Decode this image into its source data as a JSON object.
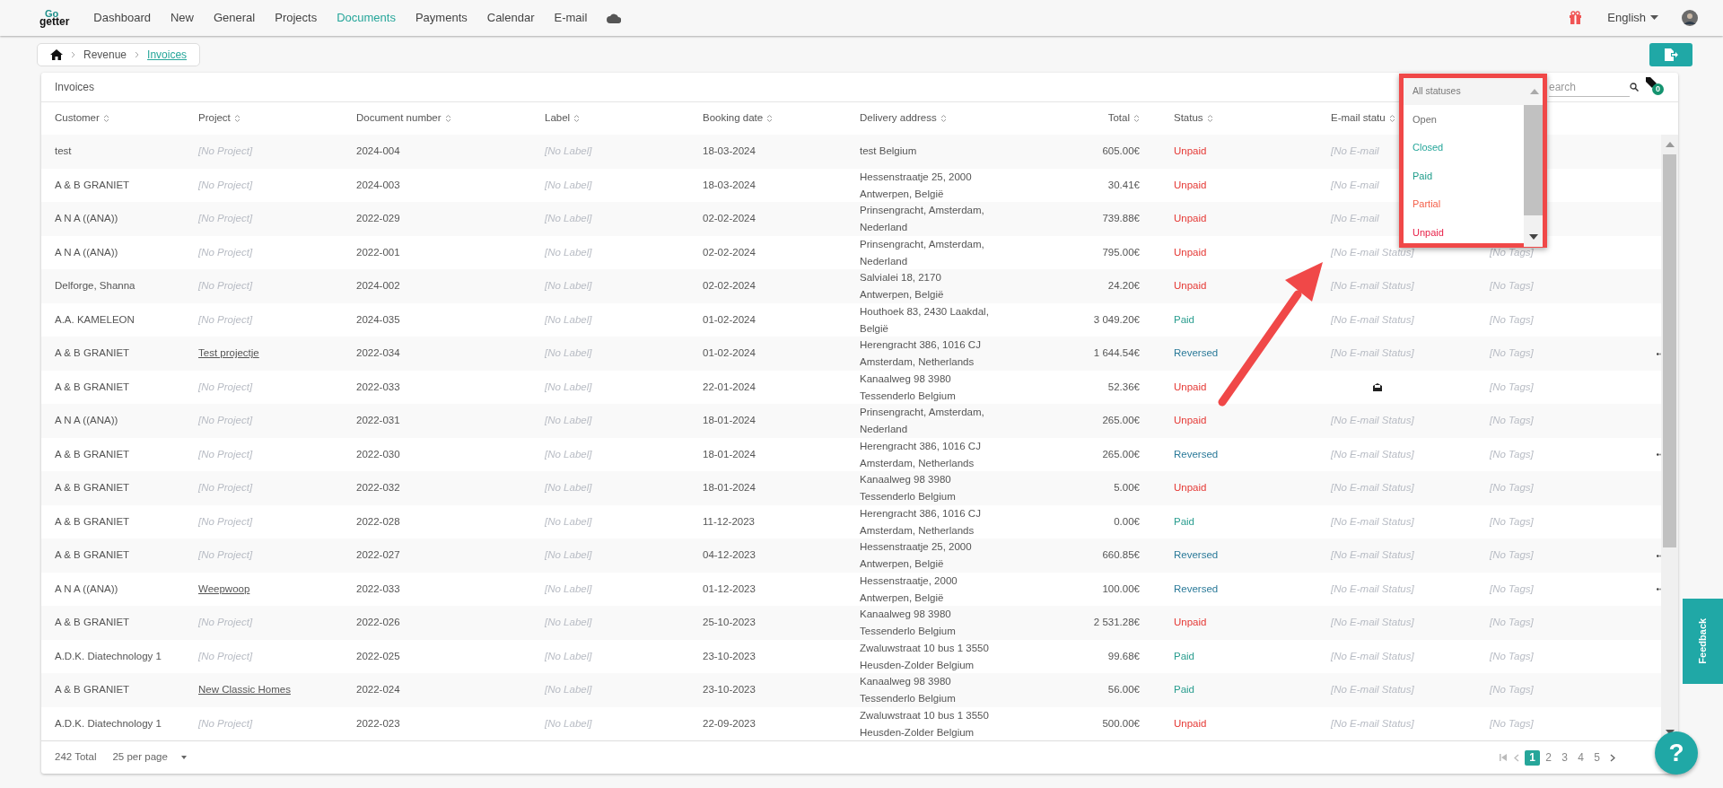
{
  "logo": {
    "top": "Go",
    "bottom": "getter"
  },
  "nav": [
    {
      "label": "Dashboard",
      "selected": false
    },
    {
      "label": "New",
      "selected": false
    },
    {
      "label": "General",
      "selected": false
    },
    {
      "label": "Projects",
      "selected": false
    },
    {
      "label": "Documents",
      "selected": true
    },
    {
      "label": "Payments",
      "selected": false
    },
    {
      "label": "Calendar",
      "selected": false
    },
    {
      "label": "E-mail",
      "selected": false
    }
  ],
  "language": "English",
  "breadcrumb": [
    "Revenue",
    "Invoices"
  ],
  "card_title": "Invoices",
  "search": {
    "placeholder": "earch"
  },
  "tag_count": "0",
  "columns": [
    "Customer",
    "Project",
    "Document number",
    "Label",
    "Booking date",
    "Delivery address",
    "Total",
    "Status",
    "E-mail statu"
  ],
  "rows": [
    {
      "customer": "test",
      "project": "[No Project]",
      "project_link": false,
      "document": "2024-004",
      "label": "[No Label]",
      "date": "18-03-2024",
      "address": [
        "test Belgium"
      ],
      "total": "605.00€",
      "status": "Unpaid",
      "color": "#e53935",
      "email_icon": false,
      "email_status": "[No E-mail",
      "menu": false
    },
    {
      "customer": "A & B GRANIET",
      "project": "[No Project]",
      "project_link": false,
      "document": "2024-003",
      "label": "[No Label]",
      "date": "18-03-2024",
      "address": [
        "Hessenstraatje 25, 2000",
        "Antwerpen, België"
      ],
      "total": "30.41€",
      "status": "Unpaid",
      "color": "#e53935",
      "email_icon": false,
      "email_status": "[No E-mail",
      "menu": false
    },
    {
      "customer": "A N A ((ANA))",
      "project": "[No Project]",
      "project_link": false,
      "document": "2022-029",
      "label": "[No Label]",
      "date": "02-02-2024",
      "address": [
        "Prinsengracht, Amsterdam,",
        "Nederland"
      ],
      "total": "739.88€",
      "status": "Unpaid",
      "color": "#e53935",
      "email_icon": false,
      "email_status": "[No E-mail",
      "menu": false
    },
    {
      "customer": "A N A ((ANA))",
      "project": "[No Project]",
      "project_link": false,
      "document": "2022-001",
      "label": "[No Label]",
      "date": "02-02-2024",
      "address": [
        "Prinsengracht, Amsterdam,",
        "Nederland"
      ],
      "total": "795.00€",
      "status": "Unpaid",
      "color": "#e53935",
      "email_icon": false,
      "email_status": "[No E-mail Status]",
      "tags": "[No Tags]",
      "menu": false
    },
    {
      "customer": "Delforge, Shanna",
      "project": "[No Project]",
      "project_link": false,
      "document": "2024-002",
      "label": "[No Label]",
      "date": "02-02-2024",
      "address": [
        "Salvialei 18, 2170",
        "Antwerpen, België"
      ],
      "total": "24.20€",
      "status": "Unpaid",
      "color": "#e53935",
      "email_icon": false,
      "email_status": "[No E-mail Status]",
      "tags": "[No Tags]",
      "menu": false
    },
    {
      "customer": "A.A. KAMELEON",
      "project": "[No Project]",
      "project_link": false,
      "document": "2024-035",
      "label": "[No Label]",
      "date": "01-02-2024",
      "address": [
        "Houthoek 83, 2430 Laakdal,",
        "België"
      ],
      "total": "3 049.20€",
      "status": "Paid",
      "color": "#2a9d8f",
      "email_icon": false,
      "email_status": "[No E-mail Status]",
      "tags": "[No Tags]",
      "menu": false
    },
    {
      "customer": "A & B GRANIET",
      "project": "Test projectje",
      "project_link": true,
      "document": "2022-034",
      "label": "[No Label]",
      "date": "01-02-2024",
      "address": [
        "Herengracht 386, 1016 CJ",
        "Amsterdam, Netherlands"
      ],
      "total": "1 644.54€",
      "status": "Reversed",
      "color": "#2b7a99",
      "email_icon": false,
      "email_status": "[No E-mail Status]",
      "tags": "[No Tags]",
      "menu": true
    },
    {
      "customer": "A & B GRANIET",
      "project": "[No Project]",
      "project_link": false,
      "document": "2022-033",
      "label": "[No Label]",
      "date": "22-01-2024",
      "address": [
        "Kanaalweg 98 3980",
        "Tessenderlo Belgium"
      ],
      "total": "52.36€",
      "status": "Unpaid",
      "color": "#e53935",
      "email_icon": true,
      "tags": "[No Tags]",
      "menu": false
    },
    {
      "customer": "A N A ((ANA))",
      "project": "[No Project]",
      "project_link": false,
      "document": "2022-031",
      "label": "[No Label]",
      "date": "18-01-2024",
      "address": [
        "Prinsengracht, Amsterdam,",
        "Nederland"
      ],
      "total": "265.00€",
      "status": "Unpaid",
      "color": "#e53935",
      "email_icon": false,
      "email_status": "[No E-mail Status]",
      "tags": "[No Tags]",
      "menu": false
    },
    {
      "customer": "A & B GRANIET",
      "project": "[No Project]",
      "project_link": false,
      "document": "2022-030",
      "label": "[No Label]",
      "date": "18-01-2024",
      "address": [
        "Herengracht 386, 1016 CJ",
        "Amsterdam, Netherlands"
      ],
      "total": "265.00€",
      "status": "Reversed",
      "color": "#2b7a99",
      "email_icon": false,
      "email_status": "[No E-mail Status]",
      "tags": "[No Tags]",
      "menu": true
    },
    {
      "customer": "A & B GRANIET",
      "project": "[No Project]",
      "project_link": false,
      "document": "2022-032",
      "label": "[No Label]",
      "date": "18-01-2024",
      "address": [
        "Kanaalweg 98 3980",
        "Tessenderlo Belgium"
      ],
      "total": "5.00€",
      "status": "Unpaid",
      "color": "#e53935",
      "email_icon": false,
      "email_status": "[No E-mail Status]",
      "tags": "[No Tags]",
      "menu": false
    },
    {
      "customer": "A & B GRANIET",
      "project": "[No Project]",
      "project_link": false,
      "document": "2022-028",
      "label": "[No Label]",
      "date": "11-12-2023",
      "address": [
        "Herengracht 386, 1016 CJ",
        "Amsterdam, Netherlands"
      ],
      "total": "0.00€",
      "status": "Paid",
      "color": "#2a9d8f",
      "email_icon": false,
      "email_status": "[No E-mail Status]",
      "tags": "[No Tags]",
      "menu": false
    },
    {
      "customer": "A & B GRANIET",
      "project": "[No Project]",
      "project_link": false,
      "document": "2022-027",
      "label": "[No Label]",
      "date": "04-12-2023",
      "address": [
        "Hessenstraatje 25, 2000",
        "Antwerpen, België"
      ],
      "total": "660.85€",
      "status": "Reversed",
      "color": "#2b7a99",
      "email_icon": false,
      "email_status": "[No E-mail Status]",
      "tags": "[No Tags]",
      "menu": true
    },
    {
      "customer": "A N A ((ANA))",
      "project": "Weepwoop",
      "project_link": true,
      "document": "2022-033",
      "label": "[No Label]",
      "date": "01-12-2023",
      "address": [
        "Hessenstraatje, 2000",
        "Antwerpen, België"
      ],
      "total": "100.00€",
      "status": "Reversed",
      "color": "#2b7a99",
      "email_icon": false,
      "email_status": "[No E-mail Status]",
      "tags": "[No Tags]",
      "menu": true
    },
    {
      "customer": "A & B GRANIET",
      "project": "[No Project]",
      "project_link": false,
      "document": "2022-026",
      "label": "[No Label]",
      "date": "25-10-2023",
      "address": [
        "Kanaalweg 98 3980",
        "Tessenderlo Belgium"
      ],
      "total": "2 531.28€",
      "status": "Unpaid",
      "color": "#e53935",
      "email_icon": false,
      "email_status": "[No E-mail Status]",
      "tags": "[No Tags]",
      "menu": false
    },
    {
      "customer": "A.D.K. Diatechnology 1",
      "project": "[No Project]",
      "project_link": false,
      "document": "2022-025",
      "label": "[No Label]",
      "date": "23-10-2023",
      "address": [
        "Zwaluwstraat 10 bus 1 3550",
        "Heusden-Zolder Belgium"
      ],
      "total": "99.68€",
      "status": "Paid",
      "color": "#2a9d8f",
      "email_icon": false,
      "email_status": "[No E-mail Status]",
      "tags": "[No Tags]",
      "menu": false
    },
    {
      "customer": "A & B GRANIET",
      "project": "New Classic Homes",
      "project_link": true,
      "document": "2022-024",
      "label": "[No Label]",
      "date": "23-10-2023",
      "address": [
        "Kanaalweg 98 3980",
        "Tessenderlo Belgium"
      ],
      "total": "56.00€",
      "status": "Paid",
      "color": "#2a9d8f",
      "email_icon": false,
      "email_status": "[No E-mail Status]",
      "tags": "[No Tags]",
      "menu": false
    },
    {
      "customer": "A.D.K. Diatechnology 1",
      "project": "[No Project]",
      "project_link": false,
      "document": "2022-023",
      "label": "[No Label]",
      "date": "22-09-2023",
      "address": [
        "Zwaluwstraat 10 bus 1 3550",
        "Heusden-Zolder Belgium"
      ],
      "total": "500.00€",
      "status": "Unpaid",
      "color": "#e53935",
      "email_icon": false,
      "email_status": "[No E-mail Status]",
      "tags": "[No Tags]",
      "menu": false
    }
  ],
  "footer": {
    "total": "242 Total",
    "per_page": "25 per page"
  },
  "pages": [
    {
      "label": "1",
      "selected": true
    },
    {
      "label": "2",
      "selected": false
    },
    {
      "label": "3",
      "selected": false
    },
    {
      "label": "4",
      "selected": false
    },
    {
      "label": "5",
      "selected": false
    }
  ],
  "status_dropdown": {
    "value": "All statuses",
    "options": [
      {
        "label": "Open",
        "color": "#707070"
      },
      {
        "label": "Closed",
        "color": "#26a69a"
      },
      {
        "label": "Paid",
        "color": "#1e9c8a"
      },
      {
        "label": "Partial",
        "color": "#f4604a"
      },
      {
        "label": "Unpaid",
        "color": "#e8234a"
      }
    ]
  },
  "feedback": "Feedback",
  "help": "?"
}
